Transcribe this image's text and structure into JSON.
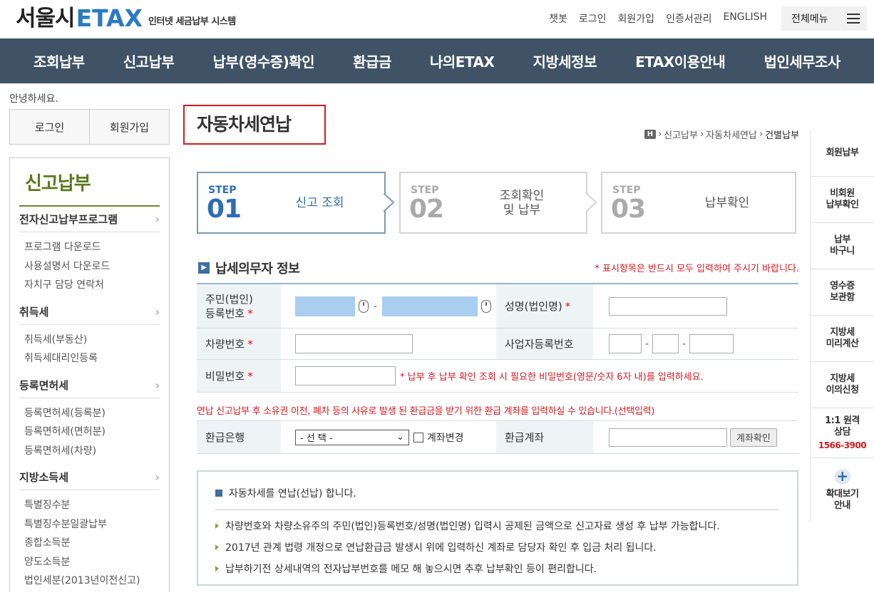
{
  "header": {
    "logo_main": "서울시",
    "logo_brand": "ETAX",
    "logo_sub": "인터넷 세금납부 시스템",
    "links": [
      "챗봇",
      "로그인",
      "회원가입",
      "인증서관리",
      "ENGLISH"
    ],
    "all_menu": "전체메뉴"
  },
  "gnb": [
    "조회납부",
    "신고납부",
    "납부(영수증)확인",
    "환급금",
    "나의ETAX",
    "지방세정보",
    "ETAX이용안내",
    "법인세무조사"
  ],
  "sidebar": {
    "greeting": "안녕하세요.",
    "login": "로그인",
    "signup": "회원가입",
    "title": "신고납부",
    "groups": [
      {
        "label": "전자신고납부프로그램",
        "items": [
          "프로그램 다운로드",
          "사용설명서 다운로드",
          "자치구 담당 연락처"
        ]
      },
      {
        "label": "취득세",
        "items": [
          "취득세(부동산)",
          "취득세대리인등록"
        ]
      },
      {
        "label": "등록면허세",
        "items": [
          "등록면허세(등록분)",
          "등록면허세(면허분)",
          "등록면허세(차량)"
        ]
      },
      {
        "label": "지방소득세",
        "items": [
          "특별징수분",
          "특별징수분일괄납부",
          "종합소득분",
          "양도소득분",
          "법인세분(2013년이전신고)"
        ]
      }
    ]
  },
  "page": {
    "title": "자동차세연납",
    "breadcrumb": [
      "신고납부",
      "자동차세연납",
      "건별납부"
    ],
    "home_icon": "H"
  },
  "steps": [
    {
      "label": "STEP",
      "num": "01",
      "text": "신고 조회"
    },
    {
      "label": "STEP",
      "num": "02",
      "text": "조회확인\n및 납부"
    },
    {
      "label": "STEP",
      "num": "03",
      "text": "납부확인"
    }
  ],
  "form": {
    "section_title": "납세의무자 정보",
    "required_note": "* 표시항목은 반드시 모두 입력하여 주시기 바랍니다.",
    "rrn_label_1": "주민(법인)",
    "rrn_label_2": "등록번호",
    "name_label": "성명(법인명)",
    "car_label": "차량번호",
    "biz_label": "사업자등록번호",
    "pw_label": "비밀번호",
    "pw_note": "* 납부 후 납부 확인 조회 시 필요한 비밀번호(영문/숫자 6자 내)를 입력하세요.",
    "dash": "-",
    "star": "*",
    "refund_notice": "연납 신고납부 후 소유권 이전, 폐차 등의 사유로 발생 된 환급금을 받기 위한 환급 계좌를 입력하실 수 있습니다.(선택입력)",
    "bank_label": "환급은행",
    "bank_selected": "- 선 택 -",
    "acct_change": "계좌변경",
    "acct_label": "환급계좌",
    "acct_confirm": "계좌확인"
  },
  "info": {
    "headline": "자동차세를 연납(선납) 합니다.",
    "items": [
      "차량번호와 차량소유주의 주민(법인)등록번호/성명(법인명) 입력시 공제된 금액으로 신고자료 생성 후 납부 가능합니다.",
      "2017년 관계 법령 개정으로 연납환급금 발생시 위에 입력하신 계좌로 담당자 확인 후 입금 처리 됩니다.",
      "납부하기전 상세내역의 전자납부번호를 메모 해 놓으시면 추후 납부확인 등이 편리합니다."
    ]
  },
  "quick": {
    "items": [
      {
        "l1": "회원납부",
        "l2": ""
      },
      {
        "l1": "비회원",
        "l2": "납부확인"
      },
      {
        "l1": "납부",
        "l2": "바구니"
      },
      {
        "l1": "영수증",
        "l2": "보관함"
      },
      {
        "l1": "지방세",
        "l2": "미리계산"
      },
      {
        "l1": "지방세",
        "l2": "이의신청"
      },
      {
        "l1": "1:1 원격",
        "l2": "상담"
      }
    ],
    "tel": "1566-3900",
    "zoom_l1": "확대보기",
    "zoom_l2": "안내"
  },
  "colors": {
    "gnb": "#3f5266",
    "brand": "#2b7bc0",
    "red": "#d7191f",
    "green": "#5b7a1c"
  }
}
